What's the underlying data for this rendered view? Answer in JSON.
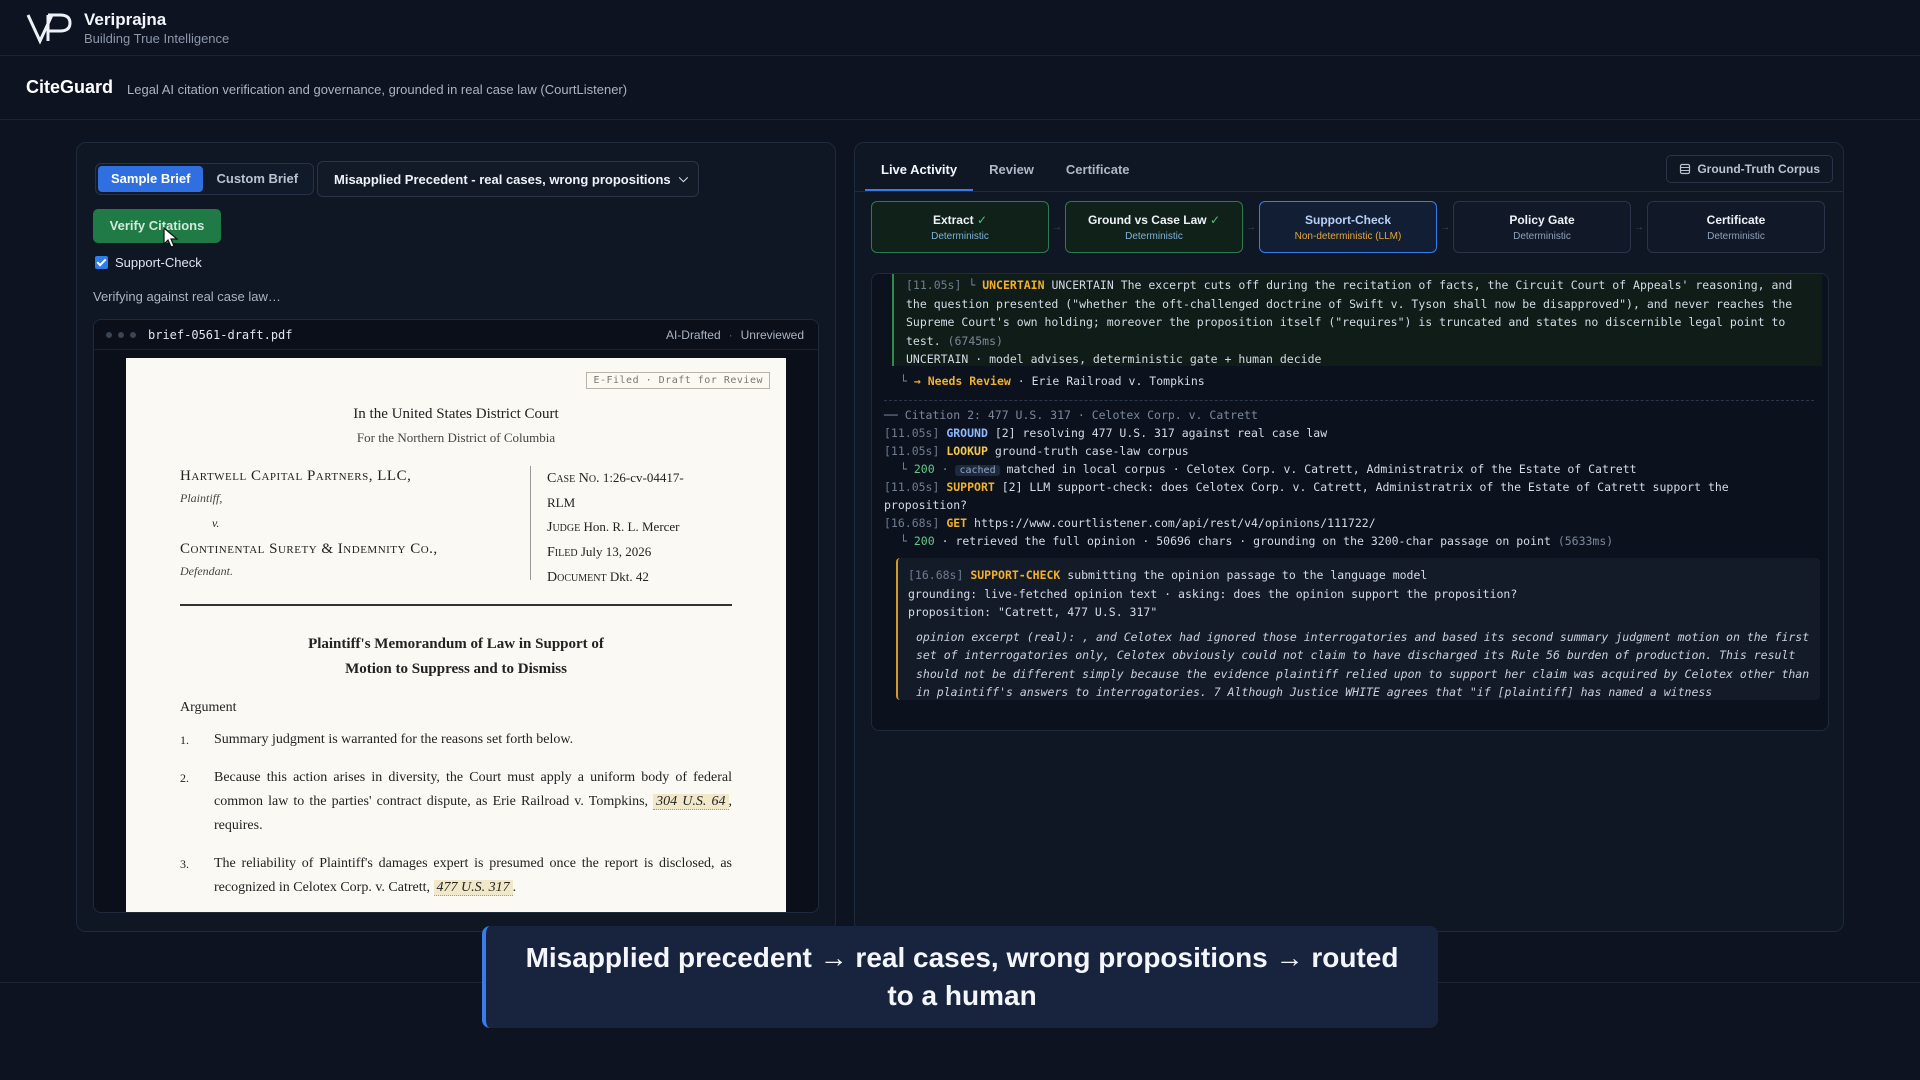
{
  "brand": {
    "name": "Veriprajna",
    "tagline": "Building True Intelligence"
  },
  "app": {
    "title": "CiteGuard",
    "subtitle": "Legal AI citation verification and governance, grounded in real case law (CourtListener)"
  },
  "left": {
    "modes": [
      "Sample Brief",
      "Custom Brief"
    ],
    "scenario": "Misapplied Precedent - real cases, wrong propositions",
    "verify_label": "Verify Citations",
    "support_check_label": "Support-Check",
    "status": "Verifying against real case law…",
    "doc": {
      "filename": "brief-0561-draft.pdf",
      "tag1": "AI-Drafted",
      "tag2": "Unreviewed",
      "stamp": "E-Filed · Draft for Review",
      "court1": "In the United States District Court",
      "court2": "For the Northern District of Columbia",
      "plaintiff": "Hartwell Capital Partners, LLC,",
      "plaintiff_role": "Plaintiff,",
      "vs": "v.",
      "defendant": "Continental Surety & Indemnity Co.,",
      "defendant_role": "Defendant.",
      "case_no_label": "Case No.",
      "case_no": "1:26-cv-04417-",
      "case_no_cont": "RLM",
      "judge_label": "Judge",
      "judge": "Hon. R. L. Mercer",
      "filed_label": "Filed",
      "filed": "July 13, 2026",
      "document_label": "Document",
      "document": "Dkt. 42",
      "title1": "Plaintiff's Memorandum of Law in Support of",
      "title2": "Motion to Suppress and to Dismiss",
      "argument": "Argument",
      "args": [
        {
          "num": "1.",
          "pre": "Summary judgment is warranted for the reasons set forth below.",
          "cite": "",
          "post": ""
        },
        {
          "num": "2.",
          "pre": "Because this action arises in diversity, the Court must apply a uniform body of federal common law to the parties' contract dispute, as Erie Railroad v. Tompkins, ",
          "cite": "304 U.S. 64",
          "post": ", requires."
        },
        {
          "num": "3.",
          "pre": "The reliability of Plaintiff's damages expert is presumed once the report is disclosed, as recognized in Celotex Corp. v. Catrett, ",
          "cite": "477 U.S. 317",
          "post": "."
        }
      ]
    }
  },
  "right": {
    "tabs": [
      "Live Activity",
      "Review",
      "Certificate"
    ],
    "corpus_label": "Ground-Truth Corpus",
    "stages": [
      {
        "name": "Extract",
        "type": "Deterministic",
        "state": "done"
      },
      {
        "name": "Ground vs Case Law",
        "type": "Deterministic",
        "state": "done"
      },
      {
        "name": "Support-Check",
        "type": "Non-deterministic (LLM)",
        "state": "active"
      },
      {
        "name": "Policy Gate",
        "type": "Deterministic",
        "state": "pending"
      },
      {
        "name": "Certificate",
        "type": "Deterministic",
        "state": "pending"
      }
    ],
    "log": {
      "unc_ts": "[11.05s]",
      "unc_kw": "UNCERTAIN",
      "unc_l1": "UNCERTAIN The excerpt cuts off during the recitation of facts, the Circuit Court of Appeals' reasoning, and",
      "unc_l2": "the question presented (\"whether the oft-challenged doctrine of Swift v. Tyson shall now be disapproved\"), and never reaches the",
      "unc_l3": "Supreme Court's own holding; moreover the proposition itself (\"requires\") is truncated and states no discernible legal point to",
      "unc_l4": "test.",
      "unc_ms": "(6745ms)",
      "unc_l5": "UNCERTAIN · model advises, deterministic gate + human decide",
      "needs_review": "→ Needs Review",
      "needs_review_case": "· Erie Railroad v. Tompkins",
      "cit2_header": "── Citation 2: 477 U.S. 317 · Celotex Corp. v. Catrett",
      "l_ground_ts": "[11.05s]",
      "l_ground_kw": "GROUND",
      "l_ground_txt": "[2] resolving 477 U.S. 317 against real case law",
      "l_lookup_ts": "[11.05s]",
      "l_lookup_kw": "LOOKUP",
      "l_lookup_txt": "ground-truth case-law corpus",
      "l_200a_code": "200",
      "l_200a_badge": "cached",
      "l_200a_txt": "matched in local corpus · Celotex Corp. v. Catrett, Administratrix of the Estate of Catrett",
      "l_support_ts": "[11.05s]",
      "l_support_kw": "SUPPORT",
      "l_support_txt": "[2] LLM support-check: does Celotex Corp. v. Catrett, Administratrix of the Estate of Catrett support the",
      "l_support_txt2": "proposition?",
      "l_get_ts": "[16.68s]",
      "l_get_kw": "GET",
      "l_get_txt": "https://www.courtlistener.com/api/rest/v4/opinions/111722/",
      "l_200b_code": "200",
      "l_200b_txt": "· retrieved the full opinion · 50696 chars · grounding on the 3200-char passage on point",
      "l_200b_ms": "(5633ms)",
      "sc_ts": "[16.68s]",
      "sc_kw": "SUPPORT-CHECK",
      "sc_txt": "submitting the opinion passage to the language model",
      "sc_l2": "grounding: live-fetched opinion text · asking: does the opinion support the proposition?",
      "sc_l3": "proposition: \"Catrett, 477 U.S. 317\"",
      "sc_excerpt": "opinion excerpt (real): , and Celotex had ignored those interrogatories and based its second summary judgment motion on the first set of interrogatories only, Celotex obviously could not claim to have discharged its Rule 56 burden of production. This result should not be different simply because the evidence plaintiff relied upon to support her claim was acquired by Celotex other than in plaintiff's answers to interrogatories. 7 Although Justice WHITE agrees that \"if [plaintiff] has named a witness"
    }
  },
  "overlay": {
    "caption": "Misapplied precedent → real cases, wrong propositions → routed to a human"
  },
  "colors": {
    "accent": "#3a7bea",
    "success": "#1f7a45",
    "warning": "#f2b02c"
  }
}
